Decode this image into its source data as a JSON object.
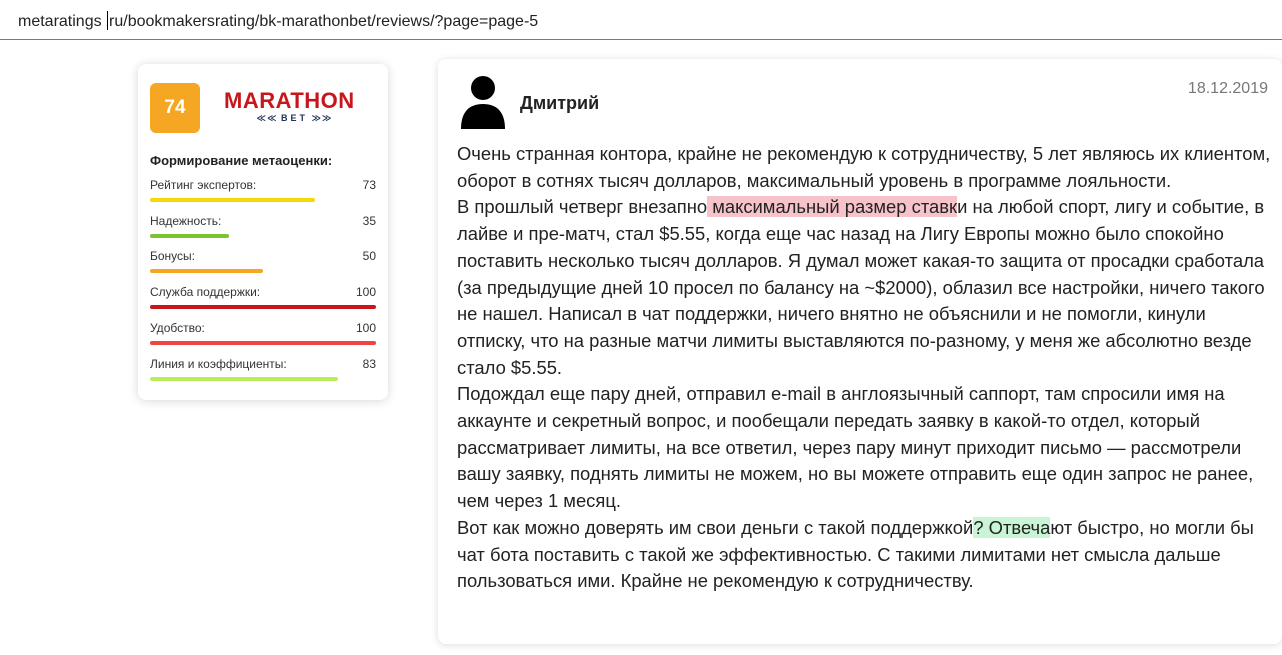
{
  "address_bar": {
    "url_before_caret": "metaratings ",
    "url_after_caret": "ru/bookmakersrating/bk-marathonbet/reviews/?page=page-5"
  },
  "rating_card": {
    "score": "74",
    "score_color": "#f5a623",
    "logo": {
      "main": "MARATHON",
      "sub": "BET"
    },
    "formation_title": "Формирование метаоценки:",
    "metrics": [
      {
        "label": "Рейтинг экспертов:",
        "value": "73",
        "fill": 0.73,
        "color": "#f5d90a"
      },
      {
        "label": "Надежность:",
        "value": "35",
        "fill": 0.35,
        "color": "#7ac52b"
      },
      {
        "label": "Бонусы:",
        "value": "50",
        "fill": 0.5,
        "color": "#f5a623"
      },
      {
        "label": "Служба поддержки:",
        "value": "100",
        "fill": 1.0,
        "color": "#c8161d"
      },
      {
        "label": "Удобство:",
        "value": "100",
        "fill": 1.0,
        "color": "#ee4444"
      },
      {
        "label": "Линия и коэффициенты:",
        "value": "83",
        "fill": 0.83,
        "color": "#b7ee5a"
      }
    ]
  },
  "review": {
    "author": "Дмитрий",
    "date": "18.12.2019",
    "paragraphs": [
      {
        "parts": [
          {
            "text": "Очень странная контора, крайне не рекомендую к сотрудничеству, 5 лет являюсь их клиентом, оборот в сотнях тысяч долларов, максимальный уровень в программе лояльности."
          }
        ]
      },
      {
        "parts": [
          {
            "text": "В прошлый четверг внезапно"
          },
          {
            "text": " максимальный размер ставк",
            "highlight": "red"
          },
          {
            "text": "и на любой спорт, лигу и событие, в лайве и пре-матч, стал $5.55, когда еще час назад на Лигу Европы можно было спокойно поставить несколько тысяч долларов. Я думал может какая-то защита от просадки сработала (за предыдущие дней 10 просел по балансу на ~$2000), облазил все настройки, ничего такого не нашел. Написал в чат поддержки, ничего внятно не объяснили и не помогли, кинули отписку, что на разные матчи лимиты выставляются по-разному, у меня же абсолютно везде стало $5.55."
          }
        ]
      },
      {
        "parts": [
          {
            "text": "Подождал еще пару дней, отправил e-mail в англоязычный саппорт, там спросили имя на аккаунте и секретный вопрос, и пообещали передать заявку в какой-то отдел, который рассматривает лимиты, на все ответил, через пару минут приходит письмо — рассмотрели вашу заявку, поднять лимиты не можем, но вы можете отправить еще один запрос не ранее, чем через 1 месяц."
          }
        ]
      },
      {
        "parts": [
          {
            "text": "Вот как можно доверять им свои деньги с такой поддержкой"
          },
          {
            "text": "? Отвеча",
            "highlight": "green"
          },
          {
            "text": "ют быстро, но могли бы чат бота поставить с такой же эффективностью. С такими лимитами нет смысла дальше пользоваться ими. Крайне не рекомендую к сотрудничеству."
          }
        ]
      }
    ]
  }
}
